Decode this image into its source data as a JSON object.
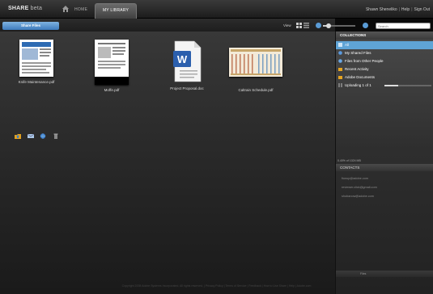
{
  "header": {
    "logo_main": "SHARE",
    "logo_beta": "beta",
    "nav_home": "HOME",
    "tab_library": "MY LIBRARY",
    "user_name": "Shawn Sheneliko",
    "help": "Help",
    "sign_out": "Sign Out"
  },
  "toolbar": {
    "share_button": "Share Files",
    "view_label": "View",
    "search_placeholder": "Search",
    "zoom_level": 0.15
  },
  "files": [
    {
      "name": "Knife Maintenance.pdf",
      "icon": "pdf-thumbnail"
    },
    {
      "name": "Moffe.pdf",
      "icon": "pdf-thumbnail"
    },
    {
      "name": "Project Proposal.doc",
      "icon": "word-document-icon"
    },
    {
      "name": "Caltrain Schedule.pdf",
      "icon": "pdf-thumbnail"
    }
  ],
  "file_actions": [
    "folder-upload-icon",
    "email-icon",
    "globe-icon",
    "trash-icon"
  ],
  "collections": {
    "header": "COLLECTIONS",
    "items": [
      {
        "label": "All",
        "icon": "all-icon",
        "selected": true
      },
      {
        "label": "My Shared Files",
        "icon": "shared-icon",
        "selected": false
      },
      {
        "label": "Files from Other People",
        "icon": "people-icon",
        "selected": false
      },
      {
        "label": "Recent Activity",
        "icon": "folder-icon",
        "selected": false
      },
      {
        "label": "Adobe Documents",
        "icon": "folder-icon",
        "selected": false
      },
      {
        "label": "Uploading 1 of 1",
        "icon": "upload-icon",
        "selected": false,
        "progress": 0.3
      }
    ]
  },
  "storage": "0.40% of 1024 MB",
  "contacts": {
    "header": "CONTACTS",
    "items": [
      "fionup@adobe.com",
      "reviewer.click@gmail.com",
      "shubanow@adobe.com"
    ]
  },
  "panel_bottom": "Files",
  "footer": "Copyright 2008 Adobe Systems Incorporated. All rights reserved. | Privacy Policy | Terms of Service | Feedback | How to Use Share | Help | Adobe.com",
  "colors": {
    "accent": "#5fa4d6",
    "button": "#3d7bbd",
    "background": "#0a0a0a"
  }
}
